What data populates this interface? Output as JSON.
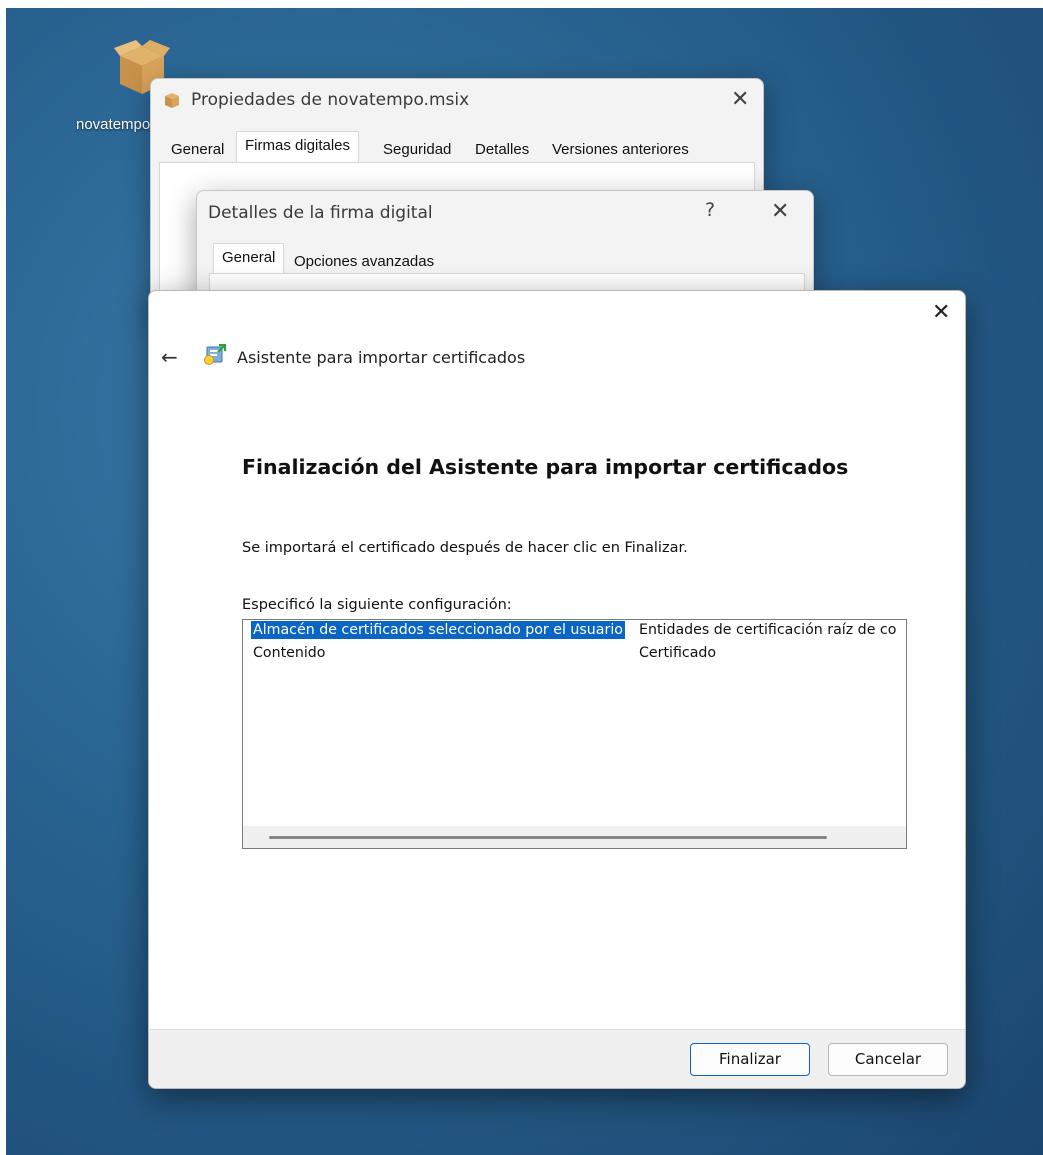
{
  "desktop": {
    "icon_label": "novatempo.msix"
  },
  "properties_window": {
    "title": "Propiedades de novatempo.msix",
    "tabs": [
      "General",
      "Firmas digitales",
      "Seguridad",
      "Detalles",
      "Versiones anteriores"
    ],
    "active_tab": "Firmas digitales"
  },
  "details_window": {
    "title": "Detalles de la firma digital",
    "help": "?",
    "tabs": [
      "General",
      "Opciones avanzadas"
    ],
    "active_tab": "General"
  },
  "wizard": {
    "app_title": "Asistente para importar certificados",
    "heading": "Finalización del Asistente para importar certificados",
    "description": "Se importará el certificado después de hacer clic en Finalizar.",
    "spec_label": "Especificó la siguiente configuración:",
    "rows": [
      {
        "name": "Almacén de certificados seleccionado por el usuario",
        "value": "Entidades de certificación raíz de co",
        "selected": true
      },
      {
        "name": "Contenido",
        "value": "Certificado",
        "selected": false
      }
    ],
    "buttons": {
      "finish": "Finalizar",
      "cancel": "Cancelar"
    }
  },
  "icons": {
    "close": "close-icon",
    "back": "back-arrow-icon",
    "package": "package-box-icon",
    "certificate": "certificate-import-icon"
  },
  "colors": {
    "selection": "#0a66c2",
    "desktop": "#2d6a98"
  }
}
